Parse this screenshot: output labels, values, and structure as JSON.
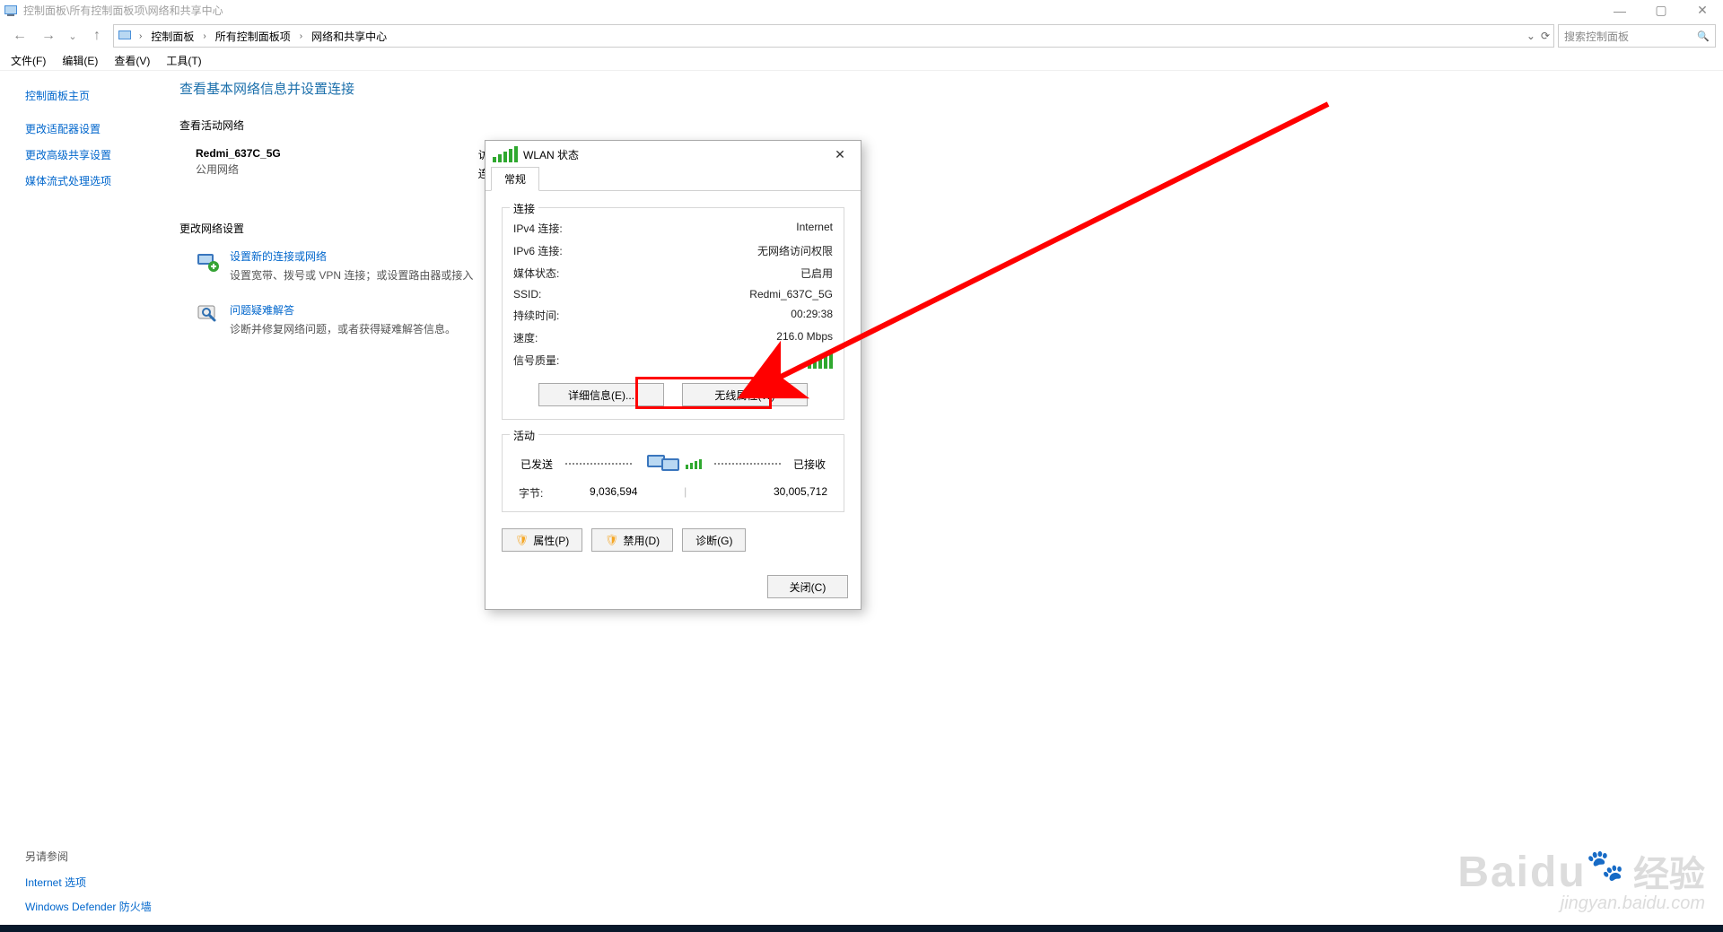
{
  "window": {
    "title": "控制面板\\所有控制面板项\\网络和共享中心",
    "min": "—",
    "max": "▢",
    "close": "✕"
  },
  "nav": {
    "back": "←",
    "forward": "→",
    "recent": "⌄",
    "up": "↑",
    "refresh": "⟳",
    "dropdown": "⌄",
    "crumbs": [
      "控制面板",
      "所有控制面板项",
      "网络和共享中心"
    ]
  },
  "search": {
    "placeholder": "搜索控制面板",
    "icon": "🔍"
  },
  "menubar": [
    "文件(F)",
    "编辑(E)",
    "查看(V)",
    "工具(T)"
  ],
  "sidebar": {
    "home": "控制面板主页",
    "links": [
      "更改适配器设置",
      "更改高级共享设置",
      "媒体流式处理选项"
    ]
  },
  "page": {
    "title": "查看基本网络信息并设置连接",
    "active_net_heading": "查看活动网络",
    "net_name": "Redmi_637C_5G",
    "net_type": "公用网络",
    "access_label": "访问",
    "conn_label": "连",
    "change_heading": "更改网络设置",
    "task1_title": "设置新的连接或网络",
    "task1_desc": "设置宽带、拨号或 VPN 连接；或设置路由器或接入",
    "task2_title": "问题疑难解答",
    "task2_desc": "诊断并修复网络问题，或者获得疑难解答信息。"
  },
  "bottom": {
    "heading": "另请参阅",
    "links": [
      "Internet 选项",
      "Windows Defender 防火墙"
    ]
  },
  "dialog": {
    "title": "WLAN 状态",
    "tab": "常规",
    "conn_legend": "连接",
    "rows": {
      "ipv4_k": "IPv4 连接:",
      "ipv4_v": "Internet",
      "ipv6_k": "IPv6 连接:",
      "ipv6_v": "无网络访问权限",
      "media_k": "媒体状态:",
      "media_v": "已启用",
      "ssid_k": "SSID:",
      "ssid_v": "Redmi_637C_5G",
      "dur_k": "持续时间:",
      "dur_v": "00:29:38",
      "speed_k": "速度:",
      "speed_v": "216.0 Mbps",
      "sig_k": "信号质量:"
    },
    "details_btn": "详细信息(E)...",
    "wireless_btn": "无线属性(W)",
    "activity_legend": "活动",
    "sent_label": "已发送",
    "recv_label": "已接收",
    "bytes_k": "字节:",
    "bytes_sent": "9,036,594",
    "bytes_recv": "30,005,712",
    "props_btn": "属性(P)",
    "disable_btn": "禁用(D)",
    "diag_btn": "诊断(G)",
    "close_btn": "关闭(C)"
  },
  "watermark": {
    "brand": "Baidu",
    "zh": "经验",
    "url": "jingyan.baidu.com"
  }
}
